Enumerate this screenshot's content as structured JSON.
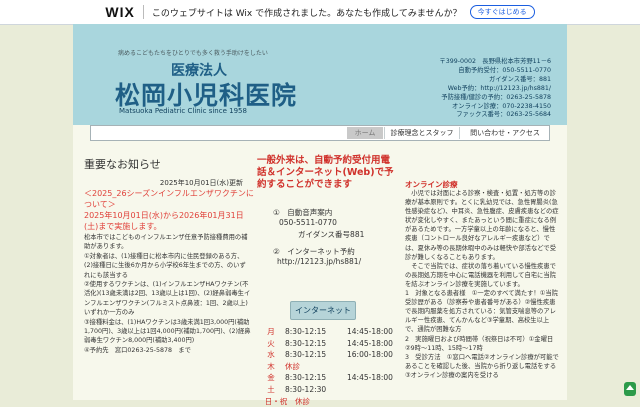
{
  "wix_banner": {
    "logo": "WIX",
    "text": "このウェブサイトは Wix で作成されました。あなたも作成してみませんか？",
    "button": "今すぐはじめる"
  },
  "header": {
    "tagline": "病めるこどもたちをひとりでも多く救う手助けをしたい",
    "corp": "医療法人",
    "name": "松岡小児科医院",
    "english": "Matsuoka Pediatric Clinic since 1958",
    "info": [
      "〒399-0002　長野県松本市芳野11－6",
      "自動予約受付：050-5511-0770",
      "ガイダンス番号：881",
      "Web予約：http://12123.jp/hs881/",
      "予防接種/健診の予約：0263-25-5878",
      "オンライン診療：070-2238-4150",
      "ファックス番号：0263-25-5684"
    ]
  },
  "nav": {
    "home": "ホーム",
    "about": "診療理念とスタッフ",
    "access": "問い合わせ・アクセス"
  },
  "news": {
    "title": "重要なお知らせ",
    "date": "2025年10月01日(水)更新",
    "headline": "＜2025_26シーズンインフルエンザワクチンについて＞",
    "period": "2025年10月01日(水)から2026年01月31日(土)まで実施します。",
    "body": [
      "松本市ではこどものインフルエンザ任意予防接種費用の補助があります。",
      "①対象者は、(1)接種日に松本市内に住民登録のある方、(2)接種日に生後6か月から小学校6年生までの方、のいずれにも該当する",
      "②使用するワクチンは、(1)インフルエンザHAワクチン(不活化)(13歳未満は2回、13歳以上は1回)、(2)経鼻弱毒生インフルエンザワクチン(フルミスト点鼻液：1回、2歳以上)いずれか一方のみ",
      "③接種料金は、(1)HAワクチンは3歳未満1回3,000円(補助1,700円)、3歳以上は1回4,000円(補助1,700円)、(2)経鼻弱毒生ワクチン8,000円(補助3,400円)",
      "④予約先　窓口0263-25-5878　まで"
    ],
    "next": "＜子宮頸がんワクチン についてのお知らせ＞"
  },
  "reservation": {
    "headline": "一般外来は、自動予約受付用電話＆インターネット(Web)で予約することができます",
    "phone_label": "①　自動音声案内",
    "phone_number": "050-5511-0770",
    "guidance": "ガイダンス番号881",
    "web_label": "②　インターネット予約",
    "web_url": "http://12123.jp/hs881/",
    "net_button": "インターネット"
  },
  "schedule": [
    {
      "day": "月",
      "am": "8:30-12:15",
      "pm": "14:45-18:00"
    },
    {
      "day": "火",
      "am": "8:30-12:15",
      "pm": "14:45-18:00"
    },
    {
      "day": "水",
      "am": "8:30-12:15",
      "pm": "16:00-18:00"
    },
    {
      "day": "木",
      "am": "休診",
      "pm": ""
    },
    {
      "day": "金",
      "am": "8:30-12:15",
      "pm": "14:45-18:00"
    },
    {
      "day": "土",
      "am": "8:30-12:30",
      "pm": ""
    },
    {
      "day": "日・祝",
      "am": "休診",
      "pm": ""
    }
  ],
  "online": {
    "title": "オンライン診療",
    "body": [
      "　小児では対面による診察・検査・処置・処方等の診療が基本原則です。とくに乳幼児では、急性胃腸炎(急性感染症など)、中耳炎、急性腹症、皮膚疾患などの症状が変化しやすく、またあっという間に重症になる例があるためです。一方学童以上の年齢になると、慢性疾患（コントロール良好なアレルギー疾患など）では、夏休み等の長期休暇中のみは軽快や部活などで受診が難しくなることもあります。",
      "　そこで当院では、症状の落ち着いている慢性疾患での長期処方期を中心に電話機器を利用して自宅に当院を結ぶオンライン診療を実施しています。",
      "1　対象となる患者様　①一定のすべて満たす！①当院受診歴がある（診察券や患者番号がある）②慢性疾患で長期内服薬を処方されている：気管支喘息等のアレルギー性疾患、てんかんなど③学童期、高校生以上で、通院が困難な方",
      "2　実施曜日および時間帯（祝祭日は不可）①金曜日②9時～11時、15時～17時",
      "3　受診方法　①窓口へ電話②オンライン診療が可能であることを確認した後、当院から折り返し電話をする③オンライン診療の案内を受ける"
    ]
  }
}
